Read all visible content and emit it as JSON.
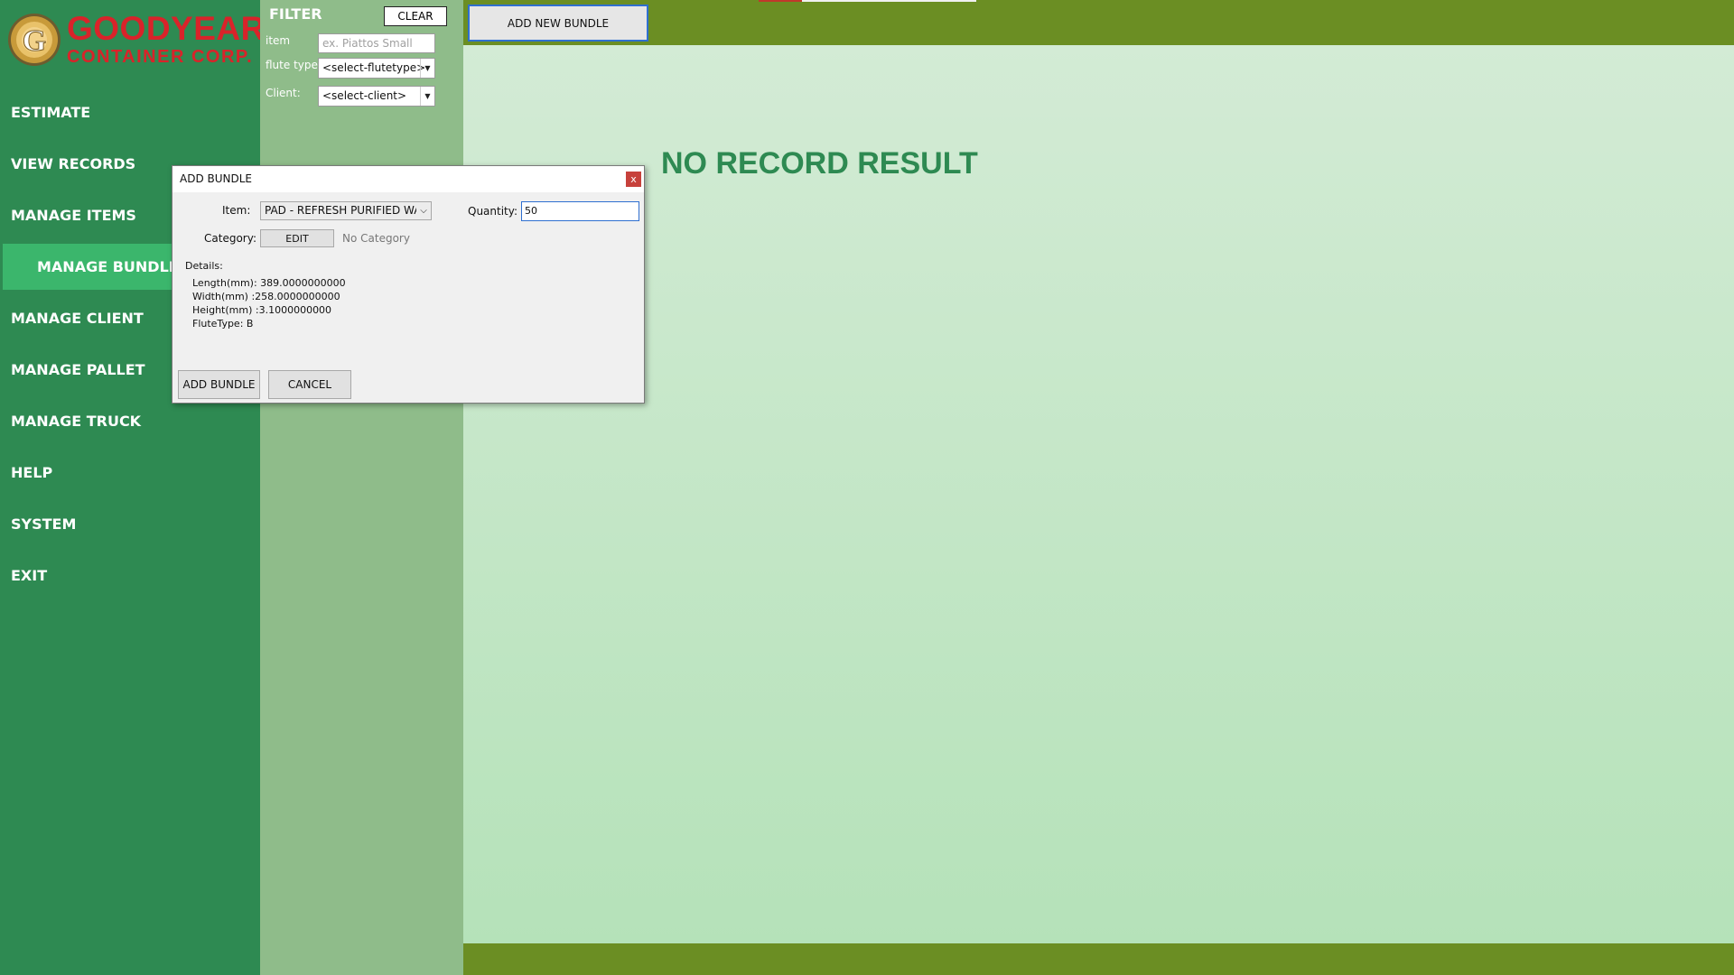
{
  "brand": {
    "line1": "GOODYEAR",
    "line2": "CONTAINER CORP."
  },
  "nav": {
    "items": [
      {
        "label": "ESTIMATE"
      },
      {
        "label": "VIEW RECORDS"
      },
      {
        "label": "MANAGE ITEMS"
      },
      {
        "label": "MANAGE BUNDLES"
      },
      {
        "label": "MANAGE CLIENT"
      },
      {
        "label": "MANAGE PALLET"
      },
      {
        "label": "MANAGE TRUCK"
      },
      {
        "label": "HELP"
      },
      {
        "label": "SYSTEM"
      },
      {
        "label": "EXIT"
      }
    ],
    "active": "MANAGE BUNDLES"
  },
  "filter": {
    "title": "FILTER",
    "clear_label": "CLEAR",
    "item_label": "item",
    "item_placeholder": "ex. Piattos Small",
    "flute_label": "flute type:",
    "flute_value": "<select-flutetype>",
    "client_label": "Client:",
    "client_value": "<select-client>"
  },
  "toolbar": {
    "add_new_label": "ADD NEW BUNDLE"
  },
  "main": {
    "empty_message": "NO RECORD RESULT"
  },
  "dialog": {
    "title": "ADD BUNDLE",
    "close_glyph": "x",
    "item_label": "Item:",
    "item_value": "PAD - REFRESH PURIFIED WATEI",
    "quantity_label": "Quantity:",
    "quantity_value": "50",
    "category_label": "Category:",
    "edit_label": "EDIT",
    "category_value": "No Category",
    "details_label": "Details:",
    "details": {
      "length": "Length(mm): 389.0000000000",
      "width": "Width(mm) :258.0000000000",
      "height": "Height(mm) :3.1000000000",
      "flute": "FluteType: B"
    },
    "add_label": "ADD BUNDLE",
    "cancel_label": "CANCEL"
  },
  "colors": {
    "sidebar": "#2e8a52",
    "sidebar_active": "#3bb66c",
    "filter_panel": "#8fbc8a",
    "topbar": "#6b8e23",
    "brand_red": "#d9232a",
    "empty_text": "#2e8a52",
    "focus_blue": "#2f6fd0",
    "close_red": "#c7413b"
  }
}
